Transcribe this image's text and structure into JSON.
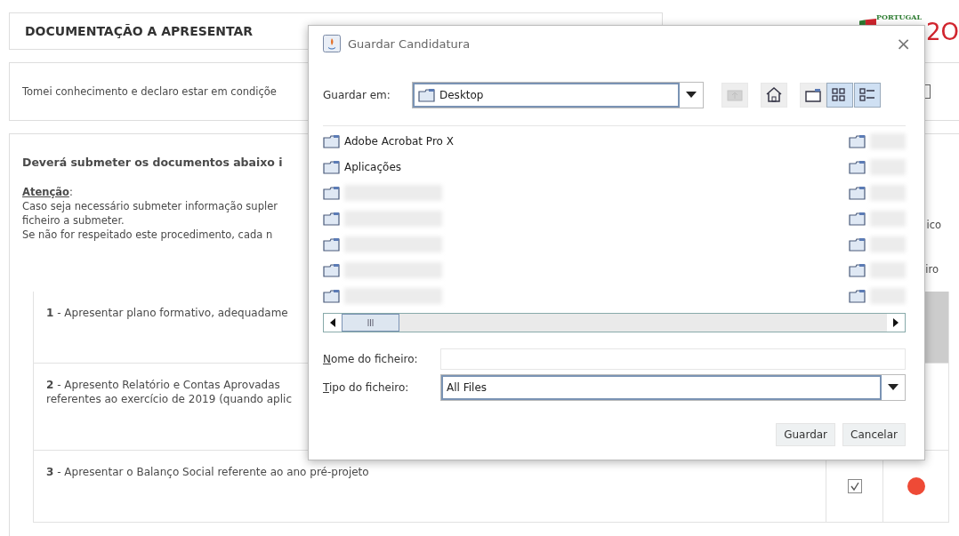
{
  "page": {
    "section_title": "DOCUMENTAÇÃO A APRESENTAR",
    "declaration": "Tomei conhecimento e declaro estar em condiçõe",
    "declaration_checked": false,
    "instructions_title": "Deverá submeter os documentos abaixo i",
    "attention_label": "Atenção",
    "attention_colon": ":",
    "attention_lines": [
      "Caso seja necessário submeter informação supler",
      "ficheiro a submeter.",
      "Se não for respeitado este procedimento, cada n"
    ],
    "attention_tail": "ico",
    "column_3_fragment": "iro",
    "rows": [
      {
        "number": "1",
        "text": "- Apresentar plano formativo, adequadame",
        "highlighted": true
      },
      {
        "number": "2",
        "text": "- Apresento Relatório e Contas Aprovadas\nreferentes ao exercício de 2019 (quando aplic",
        "highlighted": false
      },
      {
        "number": "3",
        "text": "- Apresentar o Balanço Social referente ao ano pré-projeto",
        "highlighted": false,
        "checked": true,
        "color": "#ee4a36"
      }
    ]
  },
  "logo": {
    "top": "PORTUGAL",
    "number": "2O"
  },
  "dialog": {
    "title": "Guardar Candidatura",
    "close": "×",
    "save_in_label": "Guardar em:",
    "save_in_value": "Desktop",
    "toolbar": [
      {
        "kind": "up",
        "disabled": true,
        "selected": false
      },
      {
        "kind": "home",
        "disabled": false,
        "selected": false
      },
      {
        "kind": "new-folder",
        "disabled": false,
        "selected": false
      },
      {
        "kind": "list",
        "disabled": false,
        "selected": true
      },
      {
        "kind": "details",
        "disabled": false,
        "selected": true
      }
    ],
    "files_left": [
      {
        "name": "Adobe Acrobat Pro X",
        "redacted": false
      },
      {
        "name": "Aplicações",
        "redacted": false
      },
      {
        "redacted": true
      },
      {
        "redacted": true
      },
      {
        "redacted": true
      },
      {
        "redacted": true
      },
      {
        "redacted": true
      }
    ],
    "files_right": [
      {
        "redacted": true
      },
      {
        "redacted": true
      },
      {
        "redacted": true
      },
      {
        "redacted": true
      },
      {
        "redacted": true
      },
      {
        "redacted": true
      },
      {
        "redacted": true
      }
    ],
    "filename_label": "Nome do ficheiro:",
    "filetype_label": "Tipo do ficheiro:",
    "filetype_value": "All Files",
    "buttons": [
      "Guardar",
      "Cancelar"
    ]
  }
}
